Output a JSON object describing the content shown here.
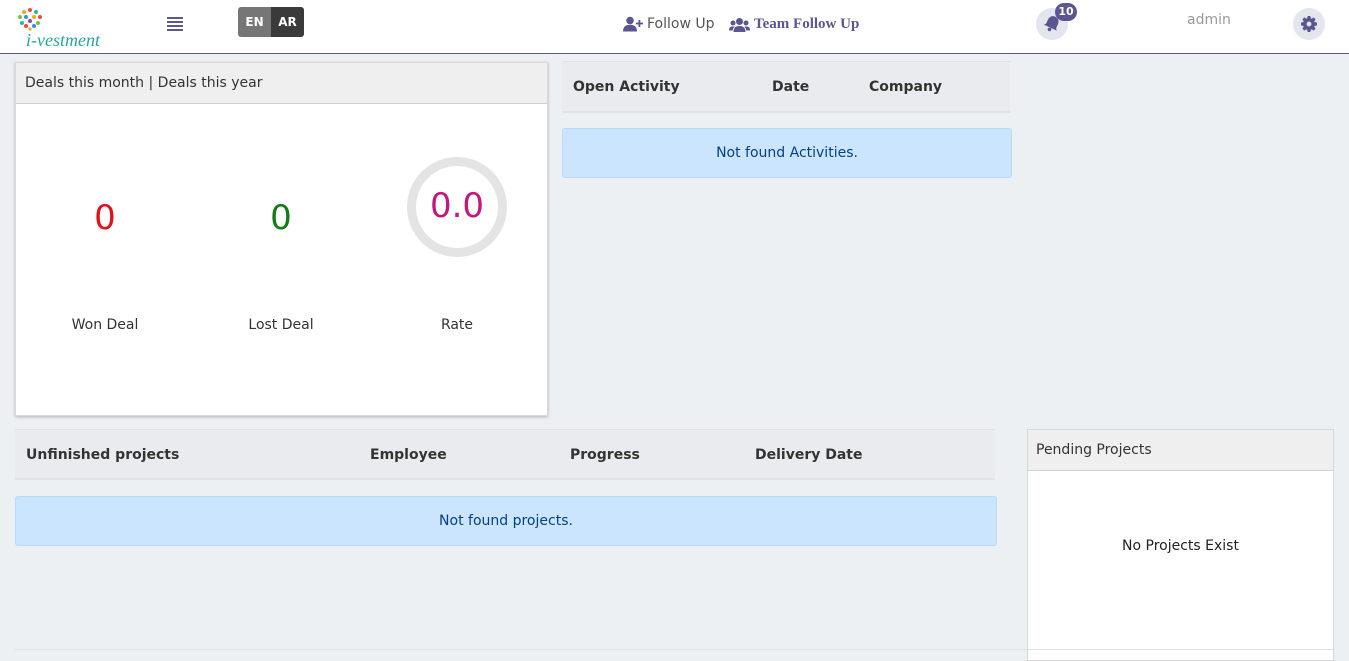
{
  "header": {
    "logo_text": "i-vestment",
    "lang_en": "EN",
    "lang_ar": "AR",
    "follow_up": "Follow Up",
    "team_follow_up": "Team Follow Up",
    "notifications_count": "10",
    "user": "admin"
  },
  "deals": {
    "title": "Deals this month | Deals this year",
    "won_value": "0",
    "won_label": "Won Deal",
    "lost_value": "0",
    "lost_label": "Lost Deal",
    "rate_value": "0.0",
    "rate_label": "Rate"
  },
  "activities": {
    "columns": [
      "Open Activity",
      "Date",
      "Company"
    ],
    "empty": "Not found Activities."
  },
  "projects": {
    "columns": [
      "Unfinished projects",
      "Employee",
      "Progress",
      "Delivery Date"
    ],
    "empty": "Not found projects."
  },
  "pending": {
    "title": "Pending Projects",
    "empty": "No Projects Exist"
  },
  "colors": {
    "brand": "#5b5591",
    "won": "#e0121a",
    "lost": "#147a14",
    "rate": "#c2177d",
    "alert_bg": "#cce5ff"
  }
}
